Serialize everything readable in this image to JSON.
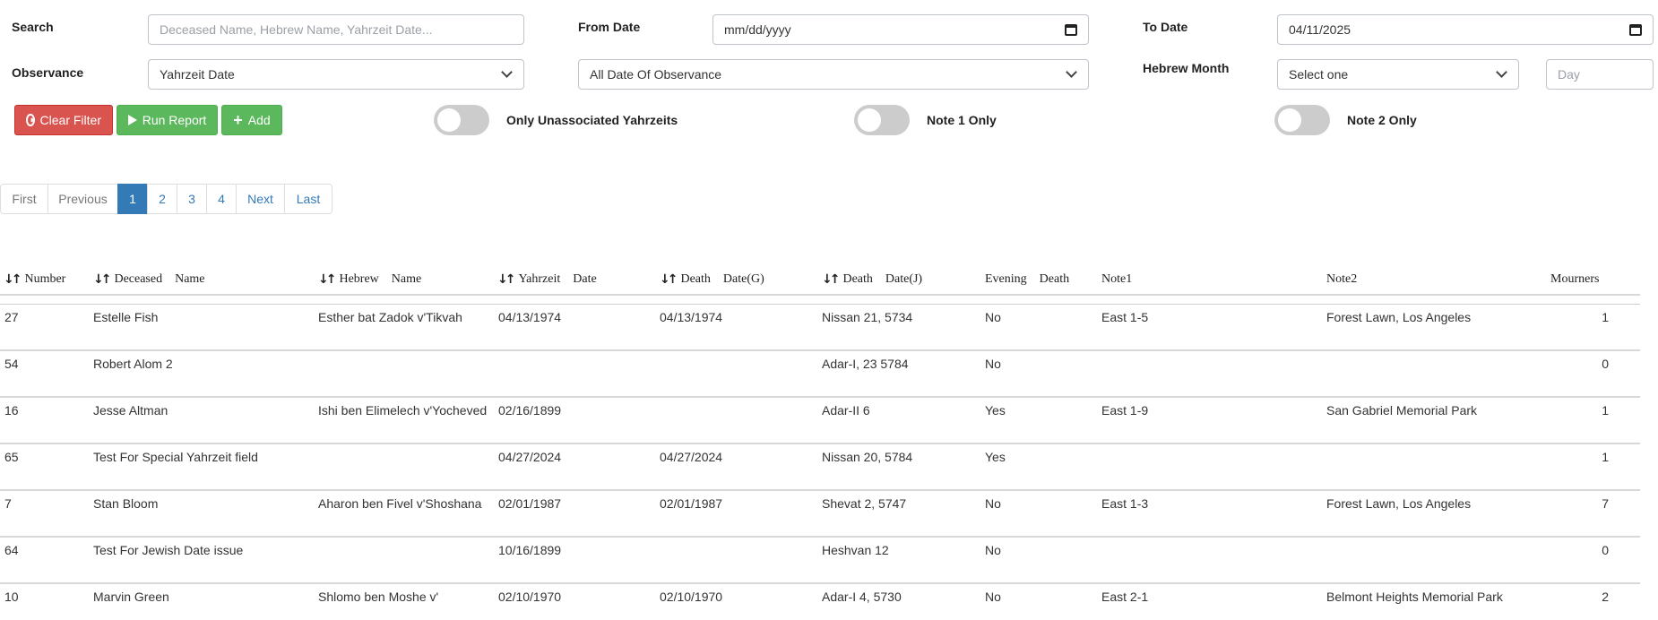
{
  "filters": {
    "search": {
      "label": "Search",
      "placeholder": "Deceased Name, Hebrew Name, Yahrzeit Date..."
    },
    "from_date": {
      "label": "From Date",
      "value": "mm/dd/yyyy"
    },
    "to_date": {
      "label": "To Date",
      "value": "04/11/2025"
    },
    "observance": {
      "label": "Observance",
      "value": "Yahrzeit Date"
    },
    "date_of_observance": {
      "value": "All Date Of Observance"
    },
    "hebrew_month": {
      "label": "Hebrew Month",
      "value": "Select one",
      "day_placeholder": "Day"
    }
  },
  "buttons": {
    "clear": "Clear Filter",
    "run": "Run Report",
    "add": "Add"
  },
  "toggles": {
    "unassociated": "Only Unassociated Yahrzeits",
    "note1": "Note 1 Only",
    "note2": "Note 2 Only"
  },
  "pagination": {
    "first": "First",
    "previous": "Previous",
    "pages": [
      "1",
      "2",
      "3",
      "4"
    ],
    "next": "Next",
    "last": "Last",
    "active": "1"
  },
  "table": {
    "headers": {
      "number": "Number",
      "deceased_name": "Deceased    Name",
      "hebrew_name": "Hebrew    Name",
      "yahrzeit_date": "Yahrzeit    Date",
      "death_date_g": "Death    Date(G)",
      "death_date_j": "Death    Date(J)",
      "evening_death": "Evening    Death",
      "note1": "Note1",
      "note2": "Note2",
      "mourners": "Mourners"
    },
    "rows": [
      {
        "number": "27",
        "deceased_name": "Estelle Fish",
        "hebrew_name": "Esther bat Zadok v'Tikvah",
        "yahrzeit_date": "04/13/1974",
        "death_date_g": "04/13/1974",
        "death_date_j": "Nissan 21, 5734",
        "evening_death": "No",
        "note1": "East 1-5",
        "note2": "Forest Lawn, Los Angeles",
        "mourners": "1"
      },
      {
        "number": "54",
        "deceased_name": "Robert Alom 2",
        "hebrew_name": "",
        "yahrzeit_date": "",
        "death_date_g": "",
        "death_date_j": "Adar-I, 23 5784",
        "evening_death": "No",
        "note1": "",
        "note2": "",
        "mourners": "0"
      },
      {
        "number": "16",
        "deceased_name": "Jesse Altman",
        "hebrew_name": "Ishi ben Elimelech v'Yocheved",
        "yahrzeit_date": "02/16/1899",
        "death_date_g": "",
        "death_date_j": "Adar-II 6",
        "evening_death": "Yes",
        "note1": "East 1-9",
        "note2": "San Gabriel Memorial Park",
        "mourners": "1"
      },
      {
        "number": "65",
        "deceased_name": "Test For Special Yahrzeit field",
        "hebrew_name": "",
        "yahrzeit_date": "04/27/2024",
        "death_date_g": "04/27/2024",
        "death_date_j": "Nissan 20, 5784",
        "evening_death": "Yes",
        "note1": "",
        "note2": "",
        "mourners": "1"
      },
      {
        "number": "7",
        "deceased_name": "Stan Bloom",
        "hebrew_name": "Aharon ben Fivel v'Shoshana",
        "yahrzeit_date": "02/01/1987",
        "death_date_g": "02/01/1987",
        "death_date_j": "Shevat 2, 5747",
        "evening_death": "No",
        "note1": "East 1-3",
        "note2": "Forest Lawn, Los Angeles",
        "mourners": "7"
      },
      {
        "number": "64",
        "deceased_name": "Test For Jewish Date issue",
        "hebrew_name": "",
        "yahrzeit_date": "10/16/1899",
        "death_date_g": "",
        "death_date_j": "Heshvan 12",
        "evening_death": "No",
        "note1": "",
        "note2": "",
        "mourners": "0"
      },
      {
        "number": "10",
        "deceased_name": "Marvin Green",
        "hebrew_name": "Shlomo ben Moshe v'",
        "yahrzeit_date": "02/10/1970",
        "death_date_g": "02/10/1970",
        "death_date_j": "Adar-I 4, 5730",
        "evening_death": "No",
        "note1": "East 2-1",
        "note2": "Belmont Heights Memorial Park",
        "mourners": "2"
      }
    ]
  }
}
